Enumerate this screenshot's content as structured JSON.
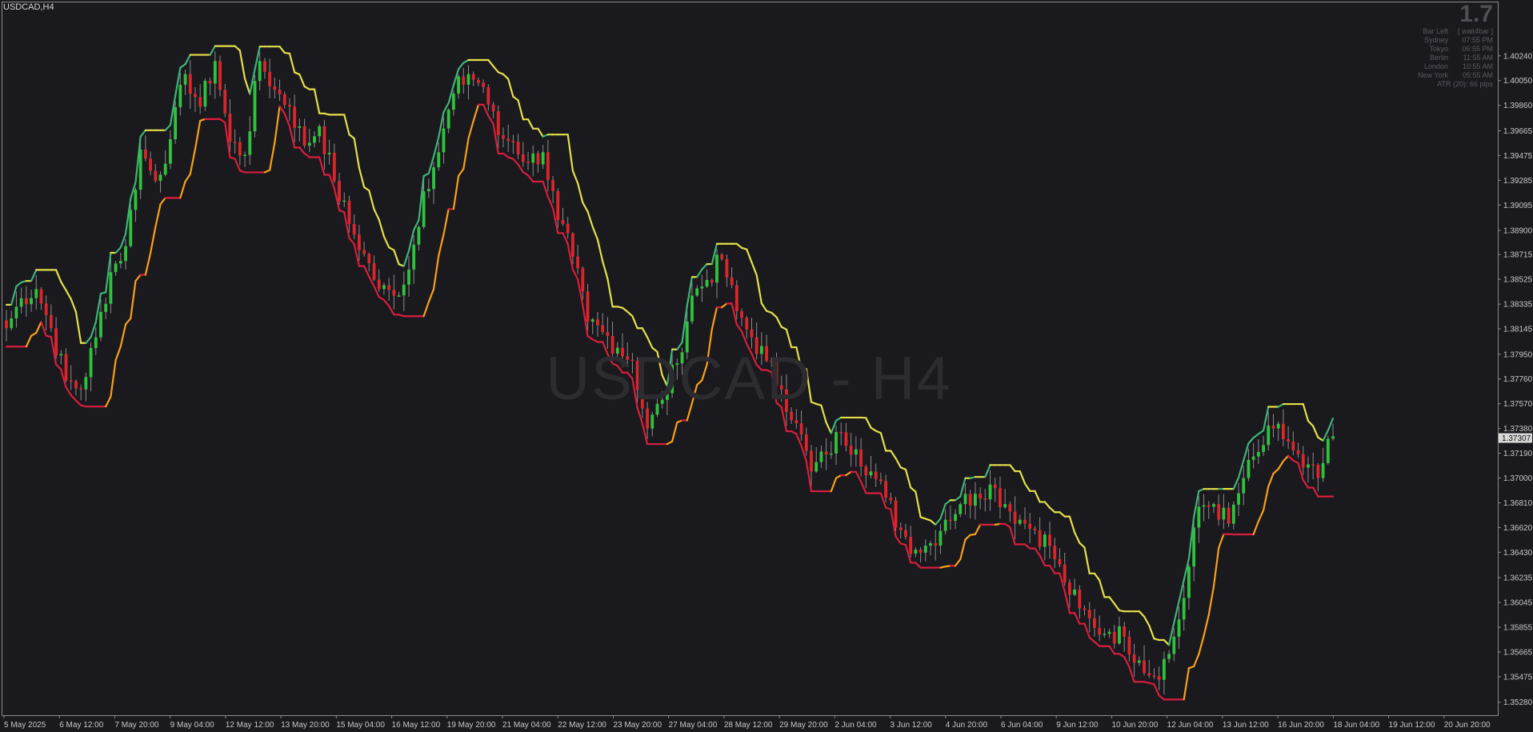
{
  "chart": {
    "symbol_label": "USDCAD,H4",
    "watermark": "USDCAD - H4",
    "current_price": "1.37307"
  },
  "info_panel": {
    "big_value": "1.7",
    "rows": [
      {
        "key": "Bar Left",
        "value": "[ wait4bar ]"
      },
      {
        "key": "Sydney",
        "value": "07:55 PM"
      },
      {
        "key": "Tokyo",
        "value": "06:55 PM"
      },
      {
        "key": "Berlin",
        "value": "11:55 AM"
      },
      {
        "key": "London",
        "value": "10:55 AM"
      },
      {
        "key": "New York",
        "value": "05:55 AM"
      }
    ],
    "atr": "ATR (20): 66 pips"
  },
  "colors": {
    "background": "#1a191e",
    "bull": "#2fc23c",
    "bear": "#d9262b",
    "upper_band": "#e4e048",
    "upper_band_alt": "#3fb37a",
    "lower_band": "#d81e3c",
    "lower_band_alt": "#f7a11a",
    "axis_text": "#c8c8c8",
    "axis_line": "#8a8a8a"
  },
  "chart_data": {
    "type": "candlestick",
    "title": "USDCAD,H4",
    "ylim": [
      1.3518,
      1.4065
    ],
    "y_ticks": [
      "1.40240",
      "1.40050",
      "1.39860",
      "1.39665",
      "1.39475",
      "1.39285",
      "1.39095",
      "1.38900",
      "1.38715",
      "1.38525",
      "1.38335",
      "1.38145",
      "1.37950",
      "1.37760",
      "1.37570",
      "1.37380",
      "1.37190",
      "1.37000",
      "1.36810",
      "1.36620",
      "1.36430",
      "1.36235",
      "1.36045",
      "1.35855",
      "1.35665",
      "1.35475",
      "1.35280"
    ],
    "x_tick_labels": [
      "5 May 2025",
      "6 May 12:00",
      "7 May 20:00",
      "9 May 04:00",
      "12 May 12:00",
      "13 May 20:00",
      "15 May 04:00",
      "16 May 12:00",
      "19 May 20:00",
      "21 May 04:00",
      "22 May 12:00",
      "23 May 20:00",
      "27 May 04:00",
      "28 May 12:00",
      "29 May 20:00",
      "2 Jun 04:00",
      "3 Jun 12:00",
      "4 Jun 20:00",
      "6 Jun 04:00",
      "9 Jun 12:00",
      "10 Jun 20:00",
      "12 Jun 04:00",
      "13 Jun 12:00",
      "16 Jun 20:00",
      "18 Jun 04:00",
      "19 Jun 12:00",
      "20 Jun 20:00"
    ],
    "close_keypoints": [
      1.3815,
      1.3838,
      1.3845,
      1.3815,
      1.3775,
      1.3768,
      1.3808,
      1.3858,
      1.3878,
      1.3952,
      1.3928,
      1.396,
      1.401,
      1.3985,
      1.402,
      1.3958,
      1.3948,
      1.402,
      1.3998,
      1.3985,
      1.3955,
      1.397,
      1.3928,
      1.3895,
      1.3872,
      1.3845,
      1.384,
      1.386,
      1.392,
      1.395,
      1.3995,
      1.401,
      1.4,
      1.3963,
      1.3958,
      1.3942,
      1.395,
      1.3898,
      1.387,
      1.382,
      1.3812,
      1.38,
      1.379,
      1.3738,
      1.376,
      1.3788,
      1.384,
      1.3852,
      1.3868,
      1.3828,
      1.3808,
      1.379,
      1.3768,
      1.3742,
      1.3705,
      1.3718,
      1.3735,
      1.3722,
      1.3705,
      1.3685,
      1.366,
      1.3645,
      1.365,
      1.3668,
      1.368,
      1.3688,
      1.3695,
      1.368,
      1.3668,
      1.366,
      1.3648,
      1.362,
      1.36,
      1.3585,
      1.3582,
      1.3578,
      1.356,
      1.3548,
      1.3565,
      1.3608,
      1.3678,
      1.368,
      1.3665,
      1.37,
      1.372,
      1.3738,
      1.3728,
      1.3708,
      1.37,
      1.3732
    ],
    "current_price": 1.37307
  }
}
